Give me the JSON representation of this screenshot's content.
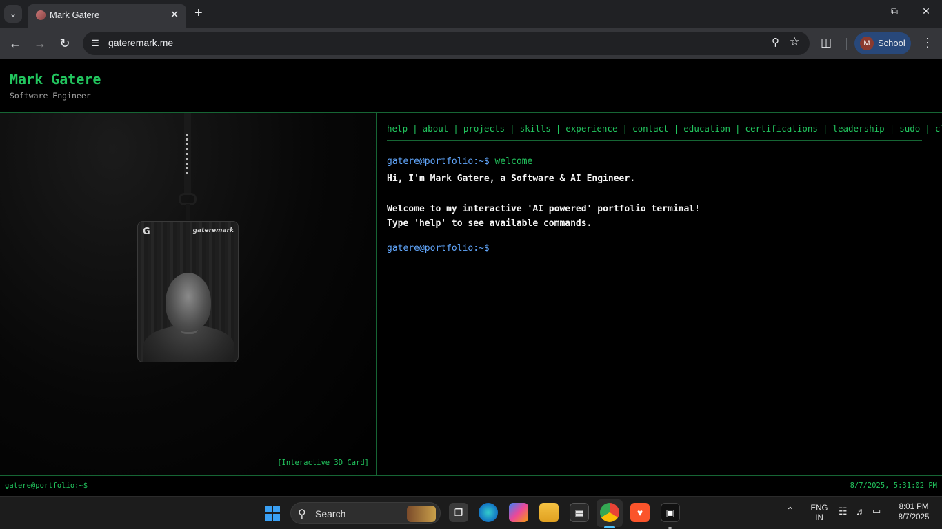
{
  "browser": {
    "tab_title": "Mark Gatere",
    "url": "gateremark.me",
    "profile_initial": "M",
    "profile_name": "School"
  },
  "site": {
    "name": "Mark Gatere",
    "subtitle": "Software Engineer",
    "card_caption": "[Interactive 3D Card]",
    "card_brand": "gateremark",
    "commands": [
      "help",
      "about",
      "projects",
      "skills",
      "experience",
      "contact",
      "education",
      "certifications",
      "leadership",
      "sudo",
      "clear"
    ],
    "terminal": {
      "prompt": "gatere@portfolio:~$",
      "first_command": "welcome",
      "lines": [
        "Hi, I'm Mark Gatere, a Software & AI Engineer.",
        "Welcome to my interactive 'AI powered' portfolio terminal!",
        "Type 'help' to see available commands."
      ]
    },
    "status": {
      "left": "gatere@portfolio:~$",
      "right": "8/7/2025, 5:31:02 PM"
    }
  },
  "taskbar": {
    "search_label": "Search",
    "lang_top": "ENG",
    "lang_bottom": "IN",
    "time": "8:01 PM",
    "date": "8/7/2025"
  },
  "colors": {
    "accent": "#22c55e",
    "prompt": "#60a5fa",
    "background": "#000000"
  }
}
